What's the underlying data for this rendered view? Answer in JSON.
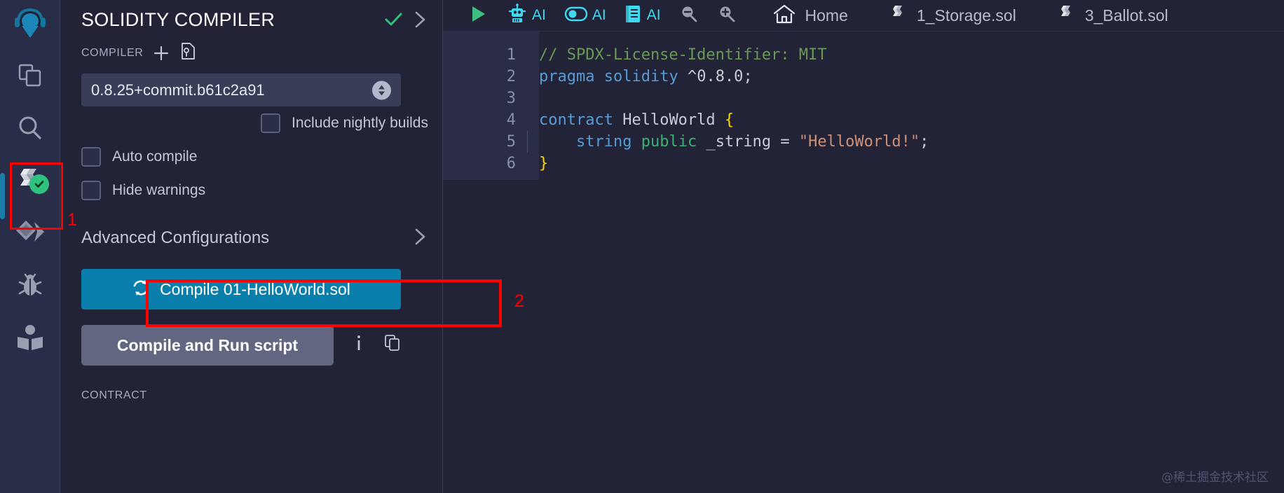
{
  "rail": {
    "logo_icon": "remix-logo-icon",
    "items": [
      {
        "name": "file-explorer-icon",
        "label": "File explorer"
      },
      {
        "name": "search-icon",
        "label": "Search in files"
      },
      {
        "name": "solidity-compiler-icon",
        "label": "Solidity compiler",
        "active": true,
        "status": "compiled-ok"
      },
      {
        "name": "deploy-run-icon",
        "label": "Deploy & run transactions"
      },
      {
        "name": "debugger-icon",
        "label": "Debugger"
      },
      {
        "name": "learneth-icon",
        "label": "Learneth"
      }
    ],
    "annotation": "1"
  },
  "panel": {
    "title": "SOLIDITY COMPILER",
    "header_check_icon": "check-icon",
    "header_chevron_icon": "chevron-right-icon",
    "compiler_label": "COMPILER",
    "add_icon": "plus-icon",
    "config_file_icon": "config-file-icon",
    "compiler_version": "0.8.25+commit.b61c2a91",
    "spinner_icon": "spinner-updown-icon",
    "nightly": {
      "label": "Include nightly builds",
      "checked": false
    },
    "auto_compile": {
      "label": "Auto compile",
      "checked": false
    },
    "hide_warnings": {
      "label": "Hide warnings",
      "checked": false
    },
    "advanced": {
      "label": "Advanced Configurations",
      "chevron_icon": "chevron-right-icon"
    },
    "compile_button": {
      "label": "Compile 01-HelloWorld.sol",
      "icon": "refresh-icon",
      "color": "#0b7fab"
    },
    "compile_annotation": "2",
    "run_script_button": {
      "label": "Compile and Run script"
    },
    "info_icon": "info-icon",
    "copy_icon": "copy-icon",
    "contract_label": "CONTRACT"
  },
  "toolbar": {
    "items": [
      {
        "name": "run-icon",
        "label": "",
        "icon": "play"
      },
      {
        "name": "ai-robot-icon",
        "label": "AI",
        "icon": "robot"
      },
      {
        "name": "ai-toggle-icon",
        "label": "AI",
        "icon": "toggle"
      },
      {
        "name": "ai-docs-icon",
        "label": "AI",
        "icon": "book"
      },
      {
        "name": "zoom-out-icon",
        "label": "",
        "icon": "zoom-out"
      },
      {
        "name": "zoom-in-icon",
        "label": "",
        "icon": "zoom-in"
      },
      {
        "name": "tab-home",
        "label": "Home",
        "icon": "home"
      },
      {
        "name": "tab-1-storage",
        "label": "1_Storage.sol",
        "icon": "solidity"
      },
      {
        "name": "tab-3-ballot",
        "label": "3_Ballot.sol",
        "icon": "solidity"
      }
    ]
  },
  "code": {
    "lines": [
      {
        "n": "1",
        "tokens": [
          {
            "t": "// SPDX-License-Identifier: MIT",
            "c": "c-comment"
          }
        ]
      },
      {
        "n": "2",
        "tokens": [
          {
            "t": "pragma",
            "c": "c-keyword"
          },
          {
            "t": " ",
            "c": "c-plain"
          },
          {
            "t": "solidity",
            "c": "c-keyword"
          },
          {
            "t": " ",
            "c": "c-plain"
          },
          {
            "t": "^0.8.0",
            "c": "c-num"
          },
          {
            "t": ";",
            "c": "c-plain"
          }
        ]
      },
      {
        "n": "3",
        "tokens": []
      },
      {
        "n": "4",
        "tokens": [
          {
            "t": "contract",
            "c": "c-keyword"
          },
          {
            "t": " HelloWorld ",
            "c": "c-plain"
          },
          {
            "t": "{",
            "c": "c-brace"
          }
        ]
      },
      {
        "n": "5",
        "indent": true,
        "tokens": [
          {
            "t": "    ",
            "c": "c-plain"
          },
          {
            "t": "string",
            "c": "c-type"
          },
          {
            "t": " ",
            "c": "c-plain"
          },
          {
            "t": "public",
            "c": "c-public"
          },
          {
            "t": " _string = ",
            "c": "c-plain"
          },
          {
            "t": "\"HelloWorld!\"",
            "c": "c-string"
          },
          {
            "t": ";",
            "c": "c-plain"
          }
        ]
      },
      {
        "n": "6",
        "tokens": [
          {
            "t": "}",
            "c": "c-brace"
          }
        ]
      }
    ]
  },
  "watermark": "@稀土掘金技术社区",
  "colors": {
    "accent_blue": "#0b7fab",
    "status_green": "#2ec27e",
    "annotation_red": "#ff0000",
    "panel_bg": "#222336",
    "rail_bg": "#2a2d47"
  }
}
